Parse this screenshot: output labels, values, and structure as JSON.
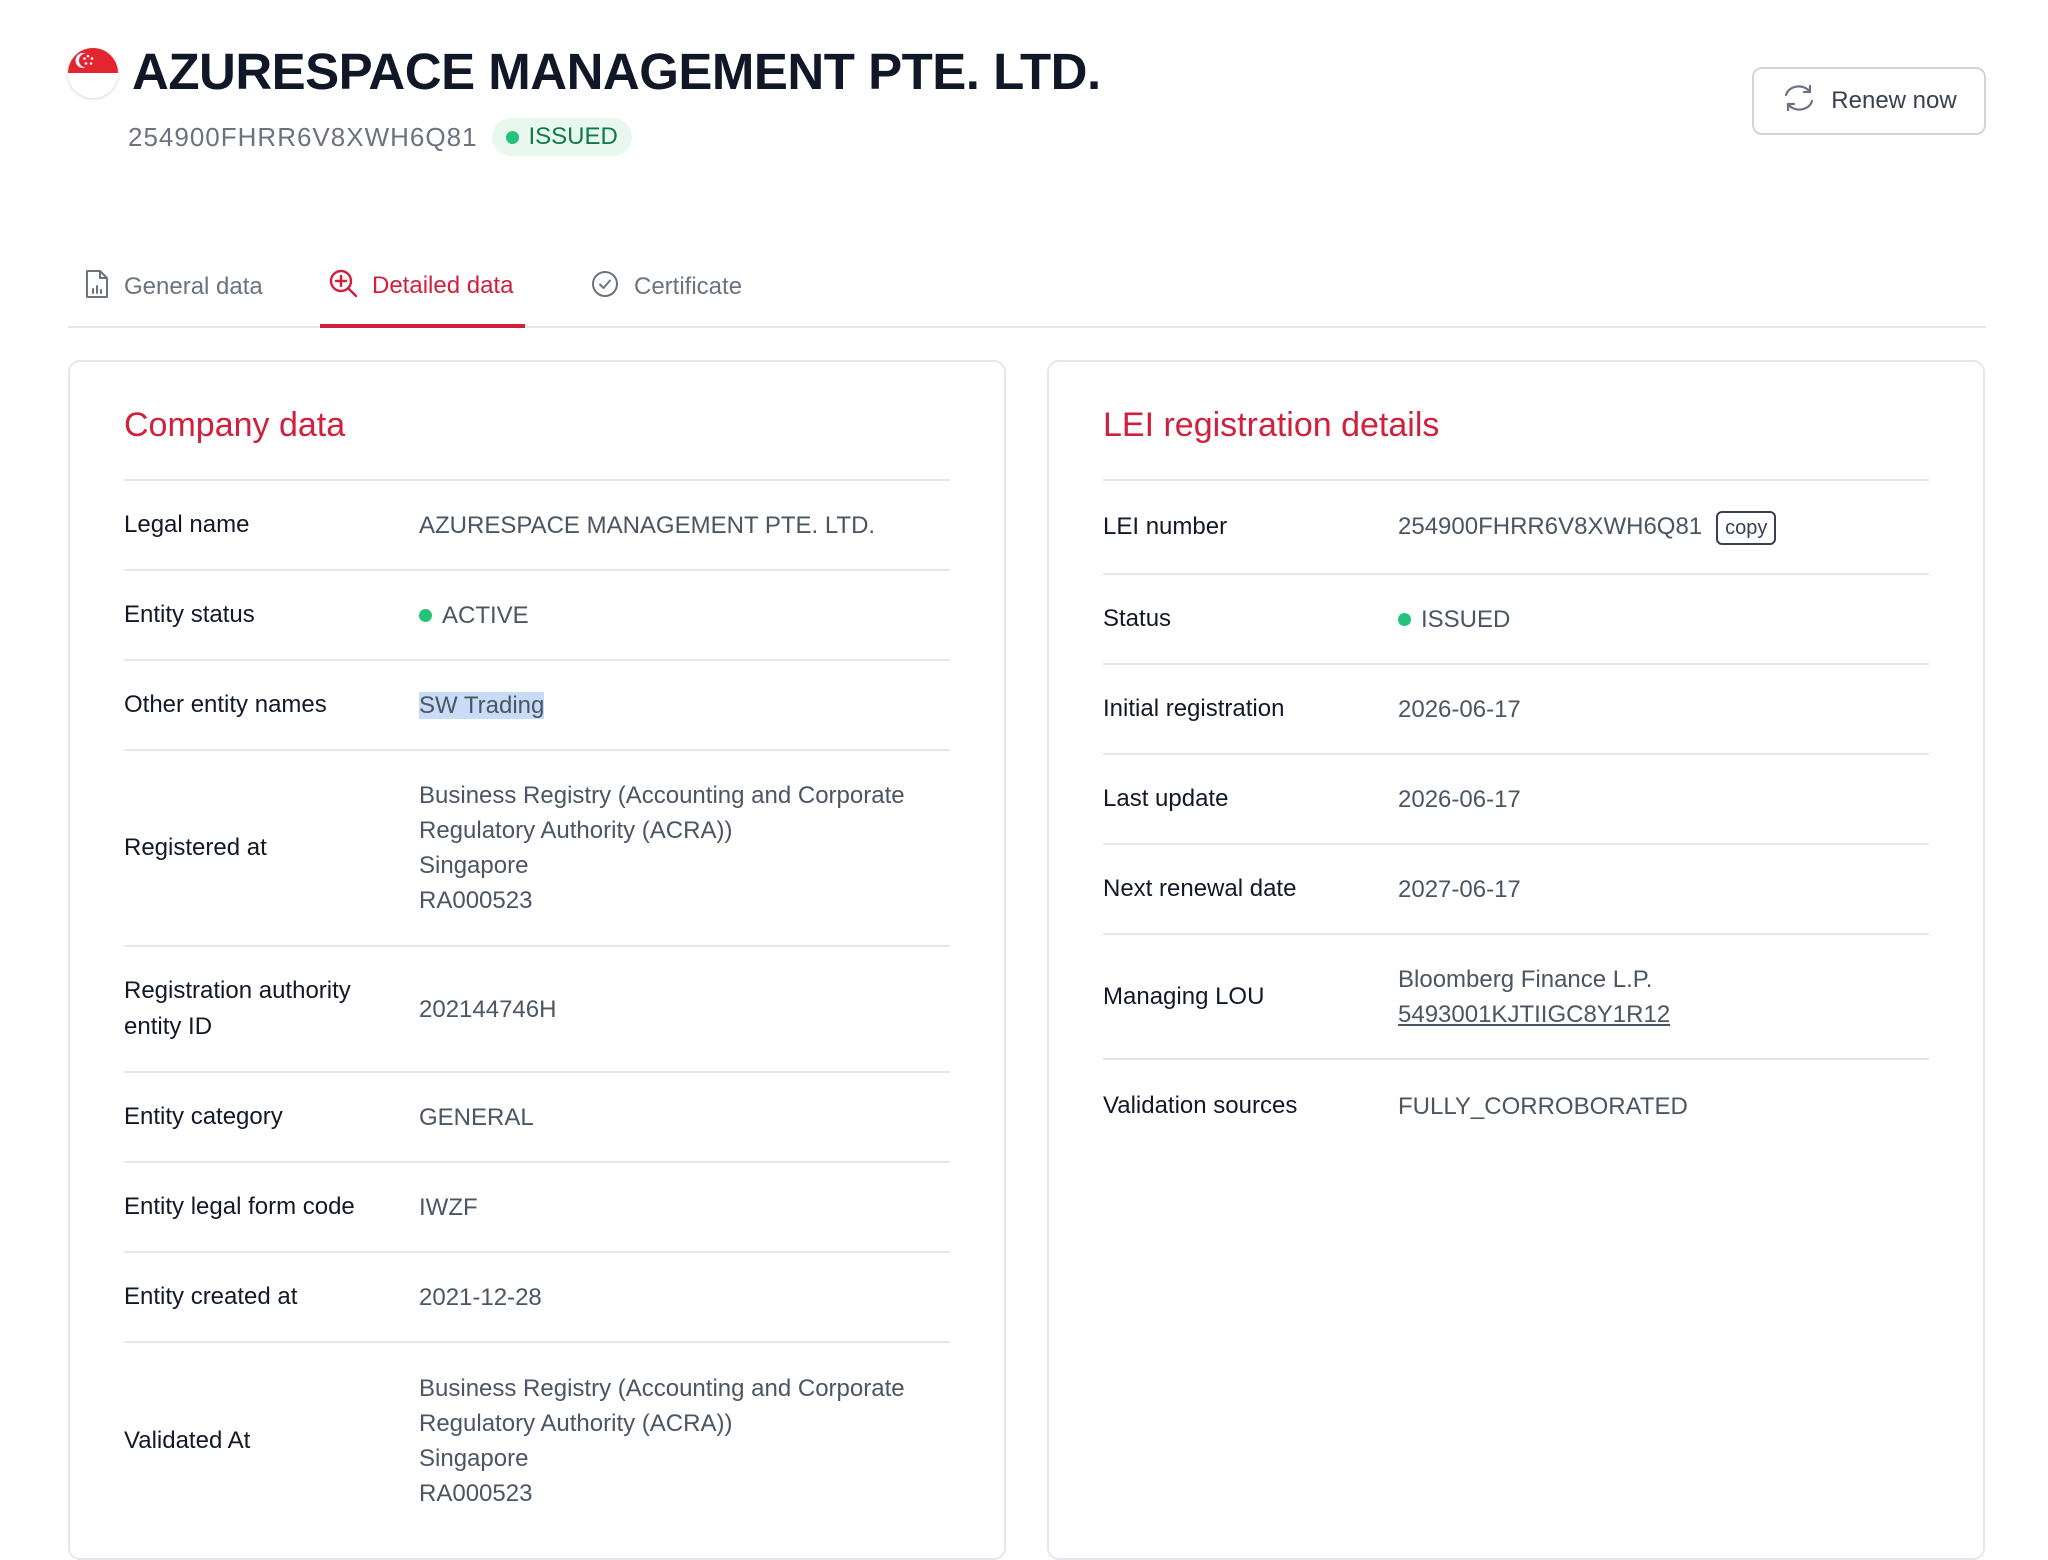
{
  "header": {
    "title": "AZURESPACE MANAGEMENT PTE. LTD.",
    "lei": "254900FHRR6V8XWH6Q81",
    "status_badge": "ISSUED",
    "flag_icon": "singapore-flag-icon",
    "renew_label": "Renew now",
    "renew_icon": "refresh-icon"
  },
  "tabs": [
    {
      "label": "General data",
      "icon": "document-chart-icon",
      "active": false
    },
    {
      "label": "Detailed data",
      "icon": "zoom-in-icon",
      "active": true
    },
    {
      "label": "Certificate",
      "icon": "check-circle-icon",
      "active": false
    }
  ],
  "company": {
    "title": "Company data",
    "rows": [
      {
        "label": "Legal name",
        "value": "AZURESPACE MANAGEMENT PTE. LTD."
      },
      {
        "label": "Entity status",
        "value": "ACTIVE"
      },
      {
        "label": "Other entity names",
        "value": "SW Trading"
      },
      {
        "label": "Registered at",
        "lines": [
          "Business Registry (Accounting and Corporate",
          "Regulatory Authority (ACRA))",
          "Singapore",
          "RA000523"
        ]
      },
      {
        "label_lines": [
          "Registration authority",
          "entity ID"
        ],
        "value": "202144746H"
      },
      {
        "label": "Entity category",
        "value": "GENERAL"
      },
      {
        "label": "Entity legal form code",
        "value": "IWZF"
      },
      {
        "label": "Entity created at",
        "value": "2021-12-28"
      },
      {
        "label": "Validated At",
        "lines": [
          "Business Registry (Accounting and Corporate",
          "Regulatory Authority (ACRA))",
          "Singapore",
          "RA000523"
        ]
      }
    ]
  },
  "lei_details": {
    "title": "LEI registration details",
    "copy_label": "copy",
    "rows": [
      {
        "label": "LEI number",
        "value": "254900FHRR6V8XWH6Q81"
      },
      {
        "label": "Status",
        "value": "ISSUED"
      },
      {
        "label": "Initial registration",
        "value": "2026-06-17"
      },
      {
        "label": "Last update",
        "value": "2026-06-17"
      },
      {
        "label": "Next renewal date",
        "value": "2027-06-17"
      },
      {
        "label": "Managing LOU",
        "lines": [
          "Bloomberg Finance L.P.",
          "5493001KJTIIGC8Y1R12"
        ]
      },
      {
        "label": "Validation sources",
        "value": "FULLY_CORROBORATED"
      }
    ]
  },
  "colors": {
    "accent": "#d21f3c",
    "status_green": "#27c27a",
    "badge_bg": "#e8f8ef",
    "highlight": "#c9dcf7"
  }
}
